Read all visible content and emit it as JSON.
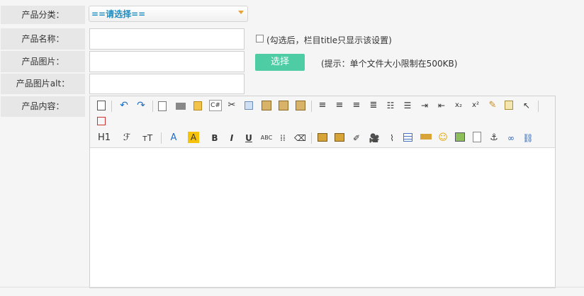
{
  "form": {
    "category_label": "产品分类：",
    "category_select": "==请选择==",
    "name_label": "产品名称：",
    "name_value": "",
    "name_checkbox_hint": "(勾选后，栏目title只显示该设置)",
    "image_label": "产品图片：",
    "image_value": "",
    "choose_button": "选择",
    "image_hint": "(提示：单个文件大小限制在500KB)",
    "alt_label": "产品图片alt：",
    "alt_value": "",
    "content_label": "产品内容："
  },
  "editor": {
    "toolbar": {
      "row2_texts": {
        "heading": "H1",
        "font_family": "ℱ",
        "font_size": "тT",
        "font_color": "A",
        "bg_color": "A",
        "bold": "B",
        "italic": "I",
        "underline": "U",
        "strikethrough": "ABC"
      },
      "subscript": "x₂",
      "superscript": "x²"
    }
  },
  "colors": {
    "accent_button": "#4ecca3",
    "select_text": "#1d8ec1",
    "label_bg": "#e7e7e7"
  }
}
